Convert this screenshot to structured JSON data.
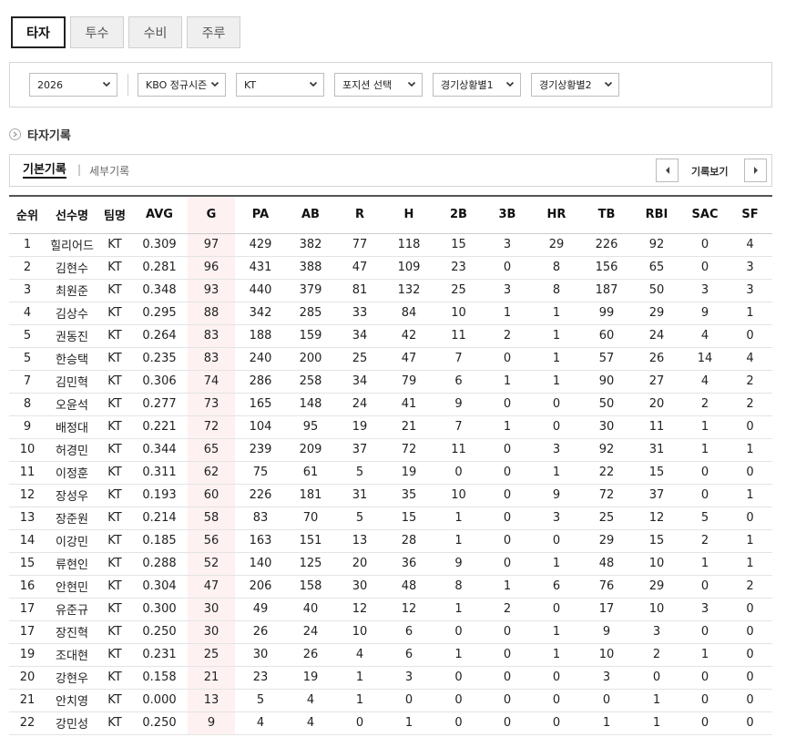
{
  "tabs": [
    "타자",
    "투수",
    "수비",
    "주루"
  ],
  "filters": {
    "year": "2026",
    "season": "KBO 정규시즌",
    "team": "KT",
    "position": "포지션 선택",
    "situation1": "경기상황별1",
    "situation2": "경기상황별2"
  },
  "section_title": "타자기록",
  "subtabs": {
    "basic": "기본기록",
    "separator": "|",
    "detail": "세부기록",
    "view_label": "기록보기"
  },
  "columns": [
    "순위",
    "선수명",
    "팀명",
    "AVG",
    "G",
    "PA",
    "AB",
    "R",
    "H",
    "2B",
    "3B",
    "HR",
    "TB",
    "RBI",
    "SAC",
    "SF"
  ],
  "rows": [
    [
      "1",
      "힐리어드",
      "KT",
      "0.309",
      "97",
      "429",
      "382",
      "77",
      "118",
      "15",
      "3",
      "29",
      "226",
      "92",
      "0",
      "4"
    ],
    [
      "2",
      "김현수",
      "KT",
      "0.281",
      "96",
      "431",
      "388",
      "47",
      "109",
      "23",
      "0",
      "8",
      "156",
      "65",
      "0",
      "3"
    ],
    [
      "3",
      "최원준",
      "KT",
      "0.348",
      "93",
      "440",
      "379",
      "81",
      "132",
      "25",
      "3",
      "8",
      "187",
      "50",
      "3",
      "3"
    ],
    [
      "4",
      "김상수",
      "KT",
      "0.295",
      "88",
      "342",
      "285",
      "33",
      "84",
      "10",
      "1",
      "1",
      "99",
      "29",
      "9",
      "1"
    ],
    [
      "5",
      "권동진",
      "KT",
      "0.264",
      "83",
      "188",
      "159",
      "34",
      "42",
      "11",
      "2",
      "1",
      "60",
      "24",
      "4",
      "0"
    ],
    [
      "5",
      "한승택",
      "KT",
      "0.235",
      "83",
      "240",
      "200",
      "25",
      "47",
      "7",
      "0",
      "1",
      "57",
      "26",
      "14",
      "4"
    ],
    [
      "7",
      "김민혁",
      "KT",
      "0.306",
      "74",
      "286",
      "258",
      "34",
      "79",
      "6",
      "1",
      "1",
      "90",
      "27",
      "4",
      "2"
    ],
    [
      "8",
      "오윤석",
      "KT",
      "0.277",
      "73",
      "165",
      "148",
      "24",
      "41",
      "9",
      "0",
      "0",
      "50",
      "20",
      "2",
      "2"
    ],
    [
      "9",
      "배정대",
      "KT",
      "0.221",
      "72",
      "104",
      "95",
      "19",
      "21",
      "7",
      "1",
      "0",
      "30",
      "11",
      "1",
      "0"
    ],
    [
      "10",
      "허경민",
      "KT",
      "0.344",
      "65",
      "239",
      "209",
      "37",
      "72",
      "11",
      "0",
      "3",
      "92",
      "31",
      "1",
      "1"
    ],
    [
      "11",
      "이정훈",
      "KT",
      "0.311",
      "62",
      "75",
      "61",
      "5",
      "19",
      "0",
      "0",
      "1",
      "22",
      "15",
      "0",
      "0"
    ],
    [
      "12",
      "장성우",
      "KT",
      "0.193",
      "60",
      "226",
      "181",
      "31",
      "35",
      "10",
      "0",
      "9",
      "72",
      "37",
      "0",
      "1"
    ],
    [
      "13",
      "장준원",
      "KT",
      "0.214",
      "58",
      "83",
      "70",
      "5",
      "15",
      "1",
      "0",
      "3",
      "25",
      "12",
      "5",
      "0"
    ],
    [
      "14",
      "이강민",
      "KT",
      "0.185",
      "56",
      "163",
      "151",
      "13",
      "28",
      "1",
      "0",
      "0",
      "29",
      "15",
      "2",
      "1"
    ],
    [
      "15",
      "류현인",
      "KT",
      "0.288",
      "52",
      "140",
      "125",
      "20",
      "36",
      "9",
      "0",
      "1",
      "48",
      "10",
      "1",
      "1"
    ],
    [
      "16",
      "안현민",
      "KT",
      "0.304",
      "47",
      "206",
      "158",
      "30",
      "48",
      "8",
      "1",
      "6",
      "76",
      "29",
      "0",
      "2"
    ],
    [
      "17",
      "유준규",
      "KT",
      "0.300",
      "30",
      "49",
      "40",
      "12",
      "12",
      "1",
      "2",
      "0",
      "17",
      "10",
      "3",
      "0"
    ],
    [
      "17",
      "장진혁",
      "KT",
      "0.250",
      "30",
      "26",
      "24",
      "10",
      "6",
      "0",
      "0",
      "1",
      "9",
      "3",
      "0",
      "0"
    ],
    [
      "19",
      "조대현",
      "KT",
      "0.231",
      "25",
      "30",
      "26",
      "4",
      "6",
      "1",
      "0",
      "1",
      "10",
      "2",
      "1",
      "0"
    ],
    [
      "20",
      "강현우",
      "KT",
      "0.158",
      "21",
      "23",
      "19",
      "1",
      "3",
      "0",
      "0",
      "0",
      "3",
      "0",
      "0",
      "0"
    ],
    [
      "21",
      "안치영",
      "KT",
      "0.000",
      "13",
      "5",
      "4",
      "1",
      "0",
      "0",
      "0",
      "0",
      "0",
      "1",
      "0",
      "0"
    ],
    [
      "22",
      "강민성",
      "KT",
      "0.250",
      "9",
      "4",
      "4",
      "0",
      "1",
      "0",
      "0",
      "0",
      "1",
      "1",
      "0",
      "0"
    ]
  ],
  "icons": {
    "dropdown": "chevron-down-icon",
    "section": "circle-arrow-icon",
    "prev": "arrow-left-icon",
    "next": "arrow-right-icon"
  },
  "colors": {
    "highlight_column": "#fdf1f2",
    "active_tab_border": "#222222"
  }
}
